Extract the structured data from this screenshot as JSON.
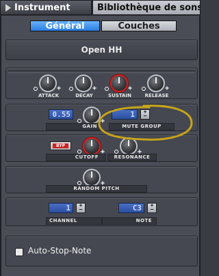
{
  "tabs": {
    "instrument": "Instrument",
    "library": "Bibliothèque de sons"
  },
  "subtabs": {
    "general": "Général",
    "layers": "Couches"
  },
  "instrument_name": "Open HH",
  "adsr": {
    "attack": "ATTACK",
    "decay": "DECAY",
    "sustain": "SUSTAIN",
    "release": "RELEASE"
  },
  "gain": {
    "value": "0.55",
    "label": "GAIN"
  },
  "mute_group": {
    "value": "1",
    "label": "MUTE GROUP"
  },
  "filter": {
    "bypass": "BYP",
    "cutoff": "CUTOFF",
    "resonance": "RESONANCE"
  },
  "random_pitch": "RANDOM PITCH",
  "channel": {
    "value": "1",
    "label": "CHANNEL"
  },
  "note": {
    "value": "C3",
    "label": "NOTE"
  },
  "auto_stop_note": "Auto-Stop-Note",
  "colors": {
    "highlight": "#c8a41a",
    "active_tab": "#2a7de0",
    "lcd": "#3a5fb4",
    "knob_red": "#d12020"
  },
  "state": {
    "sustain_knob_active": true,
    "cutoff_knob_active": true,
    "auto_stop_note_checked": false
  }
}
